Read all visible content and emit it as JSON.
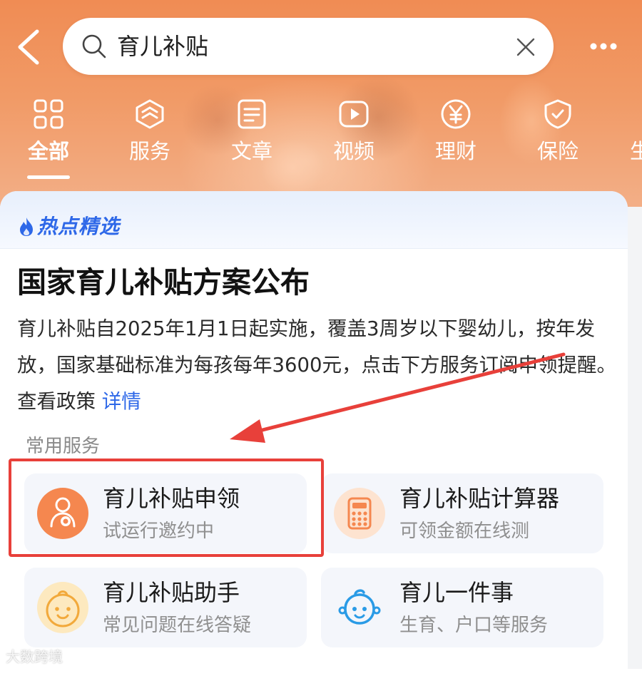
{
  "header": {
    "search_text": "育儿补贴",
    "tabs": [
      {
        "label": "全部",
        "icon": "grid-icon",
        "active": true
      },
      {
        "label": "服务",
        "icon": "cube-icon"
      },
      {
        "label": "文章",
        "icon": "article-icon"
      },
      {
        "label": "视频",
        "icon": "play-icon"
      },
      {
        "label": "理财",
        "icon": "yen-icon"
      },
      {
        "label": "保险",
        "icon": "shield-icon"
      },
      {
        "label": "生"
      }
    ]
  },
  "card": {
    "section_title": "热点精选",
    "headline": "国家育儿补贴方案公布",
    "description": "育儿补贴自2025年1月1日起实施，覆盖3周岁以下婴幼儿，按年发放，国家基础标准为每孩每年3600元，点击下方服务订阅申领提醒。查看政策",
    "details_link": "详情",
    "services_label": "常用服务",
    "services": [
      {
        "title": "育儿补贴申领",
        "subtitle": "试运行邀约中",
        "icon": "mother-baby-icon"
      },
      {
        "title": "育儿补贴计算器",
        "subtitle": "可领金额在线测",
        "icon": "calculator-icon"
      },
      {
        "title": "育儿补贴助手",
        "subtitle": "常见问题在线答疑",
        "icon": "baby-face-icon"
      },
      {
        "title": "育儿一件事",
        "subtitle": "生育、户口等服务",
        "icon": "baby-outline-icon"
      }
    ]
  },
  "watermark": "大数跨境",
  "colors": {
    "header_orange": "#f08c54",
    "link_blue": "#2e68e8",
    "highlight_red": "#e8403a",
    "icon_orange": "#f5874f"
  }
}
